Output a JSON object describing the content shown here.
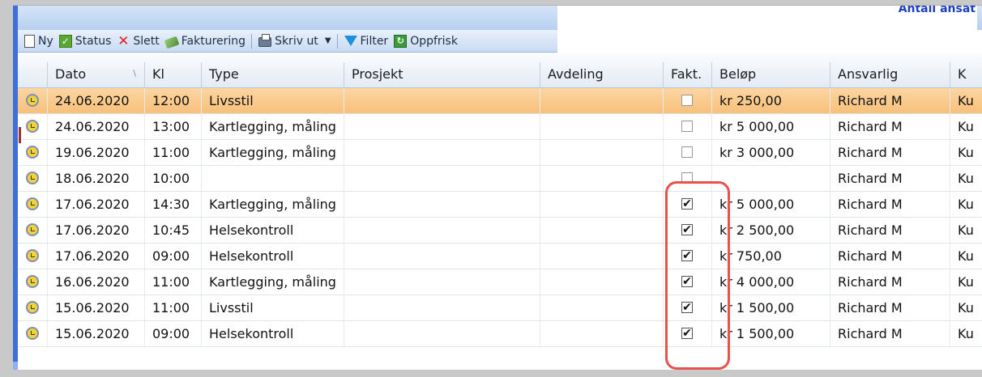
{
  "header_note": "Antall ansat",
  "toolbar": {
    "new_label": "Ny",
    "status_label": "Status",
    "delete_label": "Slett",
    "invoice_label": "Fakturering",
    "print_label": "Skriv ut",
    "filter_label": "Filter",
    "refresh_label": "Oppfrisk"
  },
  "columns": {
    "date": "Dato",
    "time": "Kl",
    "type": "Type",
    "project": "Prosjekt",
    "department": "Avdeling",
    "invoiced": "Fakt.",
    "amount": "Beløp",
    "responsible": "Ansvarlig",
    "extra": "K"
  },
  "rows": [
    {
      "date": "24.06.2020",
      "time": "12:00",
      "type": "Livsstil",
      "project": "",
      "department": "",
      "invoiced": false,
      "amount": "kr 250,00",
      "responsible": "Richard M",
      "extra": "Ku",
      "selected": true
    },
    {
      "date": "24.06.2020",
      "time": "13:00",
      "type": "Kartlegging, måling",
      "project": "",
      "department": "",
      "invoiced": false,
      "amount": "kr 5 000,00",
      "responsible": "Richard M",
      "extra": "Ku",
      "selected": false
    },
    {
      "date": "19.06.2020",
      "time": "11:00",
      "type": "Kartlegging, måling",
      "project": "",
      "department": "",
      "invoiced": false,
      "amount": "kr 3 000,00",
      "responsible": "Richard M",
      "extra": "Ku",
      "selected": false
    },
    {
      "date": "18.06.2020",
      "time": "10:00",
      "type": "",
      "project": "",
      "department": "",
      "invoiced": false,
      "amount": "",
      "responsible": "Richard M",
      "extra": "Ku",
      "selected": false
    },
    {
      "date": "17.06.2020",
      "time": "14:30",
      "type": "Kartlegging, måling",
      "project": "",
      "department": "",
      "invoiced": true,
      "amount": "kr 5 000,00",
      "responsible": "Richard M",
      "extra": "Ku",
      "selected": false
    },
    {
      "date": "17.06.2020",
      "time": "10:45",
      "type": "Helsekontroll",
      "project": "",
      "department": "",
      "invoiced": true,
      "amount": "kr 2 500,00",
      "responsible": "Richard M",
      "extra": "Ku",
      "selected": false
    },
    {
      "date": "17.06.2020",
      "time": "09:00",
      "type": "Helsekontroll",
      "project": "",
      "department": "",
      "invoiced": true,
      "amount": "kr 750,00",
      "responsible": "Richard M",
      "extra": "Ku",
      "selected": false
    },
    {
      "date": "16.06.2020",
      "time": "11:00",
      "type": "Kartlegging, måling",
      "project": "",
      "department": "",
      "invoiced": true,
      "amount": "kr 4 000,00",
      "responsible": "Richard M",
      "extra": "Ku",
      "selected": false
    },
    {
      "date": "15.06.2020",
      "time": "11:00",
      "type": "Livsstil",
      "project": "",
      "department": "",
      "invoiced": true,
      "amount": "kr 1 500,00",
      "responsible": "Richard M",
      "extra": "Ku",
      "selected": false
    },
    {
      "date": "15.06.2020",
      "time": "09:00",
      "type": "Helsekontroll",
      "project": "",
      "department": "",
      "invoiced": true,
      "amount": "kr 1 500,00",
      "responsible": "Richard M",
      "extra": "Ku",
      "selected": false
    }
  ],
  "colors": {
    "selected_row": "#f8c07a",
    "highlight_outline": "#e8524c",
    "toolbar_bg": "#c8daf2",
    "accent_blue": "#3f6fd8"
  },
  "icons": {
    "row_icon": "alarm-clock-icon",
    "checkbox_checked": "checkmark-icon"
  }
}
